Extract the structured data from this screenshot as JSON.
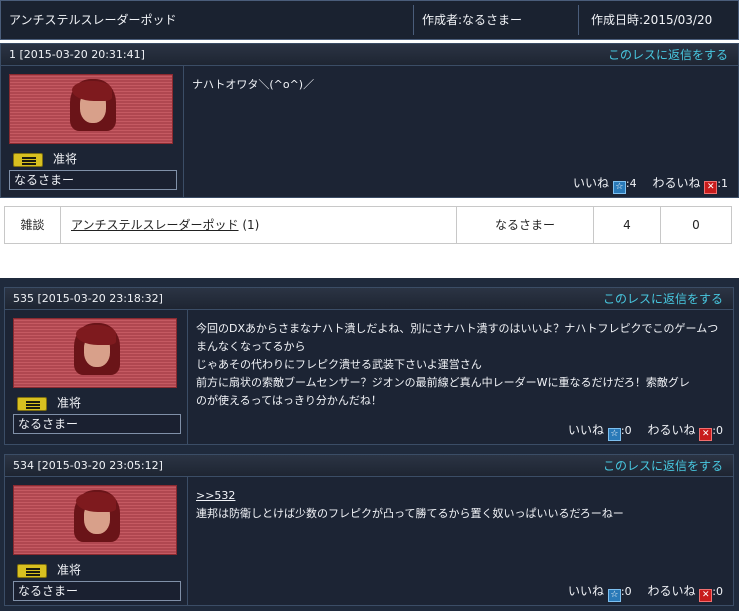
{
  "thread": {
    "title": "アンチステルスレーダーポッド",
    "author_label": "作成者:なるさまー",
    "created_label": "作成日時:2015/03/20"
  },
  "reply_label": "このレスに返信をする",
  "vote": {
    "good_label": "いいね",
    "bad_label": "わるいね"
  },
  "posts": [
    {
      "header": "1 [2015-03-20 20:31:41]",
      "rank": "准将",
      "user": "なるさまー",
      "text": "ナハトオワタ＼(^o^)／",
      "good": ":4",
      "bad": ":1"
    },
    {
      "header": "535 [2015-03-20 23:18:32]",
      "rank": "准将",
      "user": "なるさまー",
      "text": "今回のDXあからさまなナハト潰しだよね、別にさナハト潰すのはいいよ？ナハトフレピクでこのゲームつ\nまんなくなってるから\nじゃあその代わりにフレピク潰せる武装下さいよ運営さん\n前方に扇状の索敵ブームセンサー？ジオンの最前線ど真ん中レーダーWに重なるだけだろ！索敵グレ\nのが使えるってはっきり分かんだね！",
      "good": ":0",
      "bad": ":0"
    },
    {
      "header": "534 [2015-03-20 23:05:12]",
      "rank": "准将",
      "user": "なるさまー",
      "anchor": ">>532",
      "text": "連邦は防衛しとけば少数のフレピクが凸って勝てるから置く奴いっぱいいるだろーねー",
      "good": ":0",
      "bad": ":0"
    }
  ],
  "table": {
    "category": "雑談",
    "thread_link": "アンチステルスレーダーポッド",
    "count": "(1)",
    "user": "なるさまー",
    "good": "4",
    "bad": "0"
  },
  "icons": [
    "rank-badge-icon",
    "good-star-icon",
    "bad-x-icon"
  ],
  "colors": {
    "reply_link": "#48c8e0",
    "good_icon": "#2a7ab8",
    "bad_icon": "#c81c1c",
    "avatar_bg": "#c55a62"
  }
}
